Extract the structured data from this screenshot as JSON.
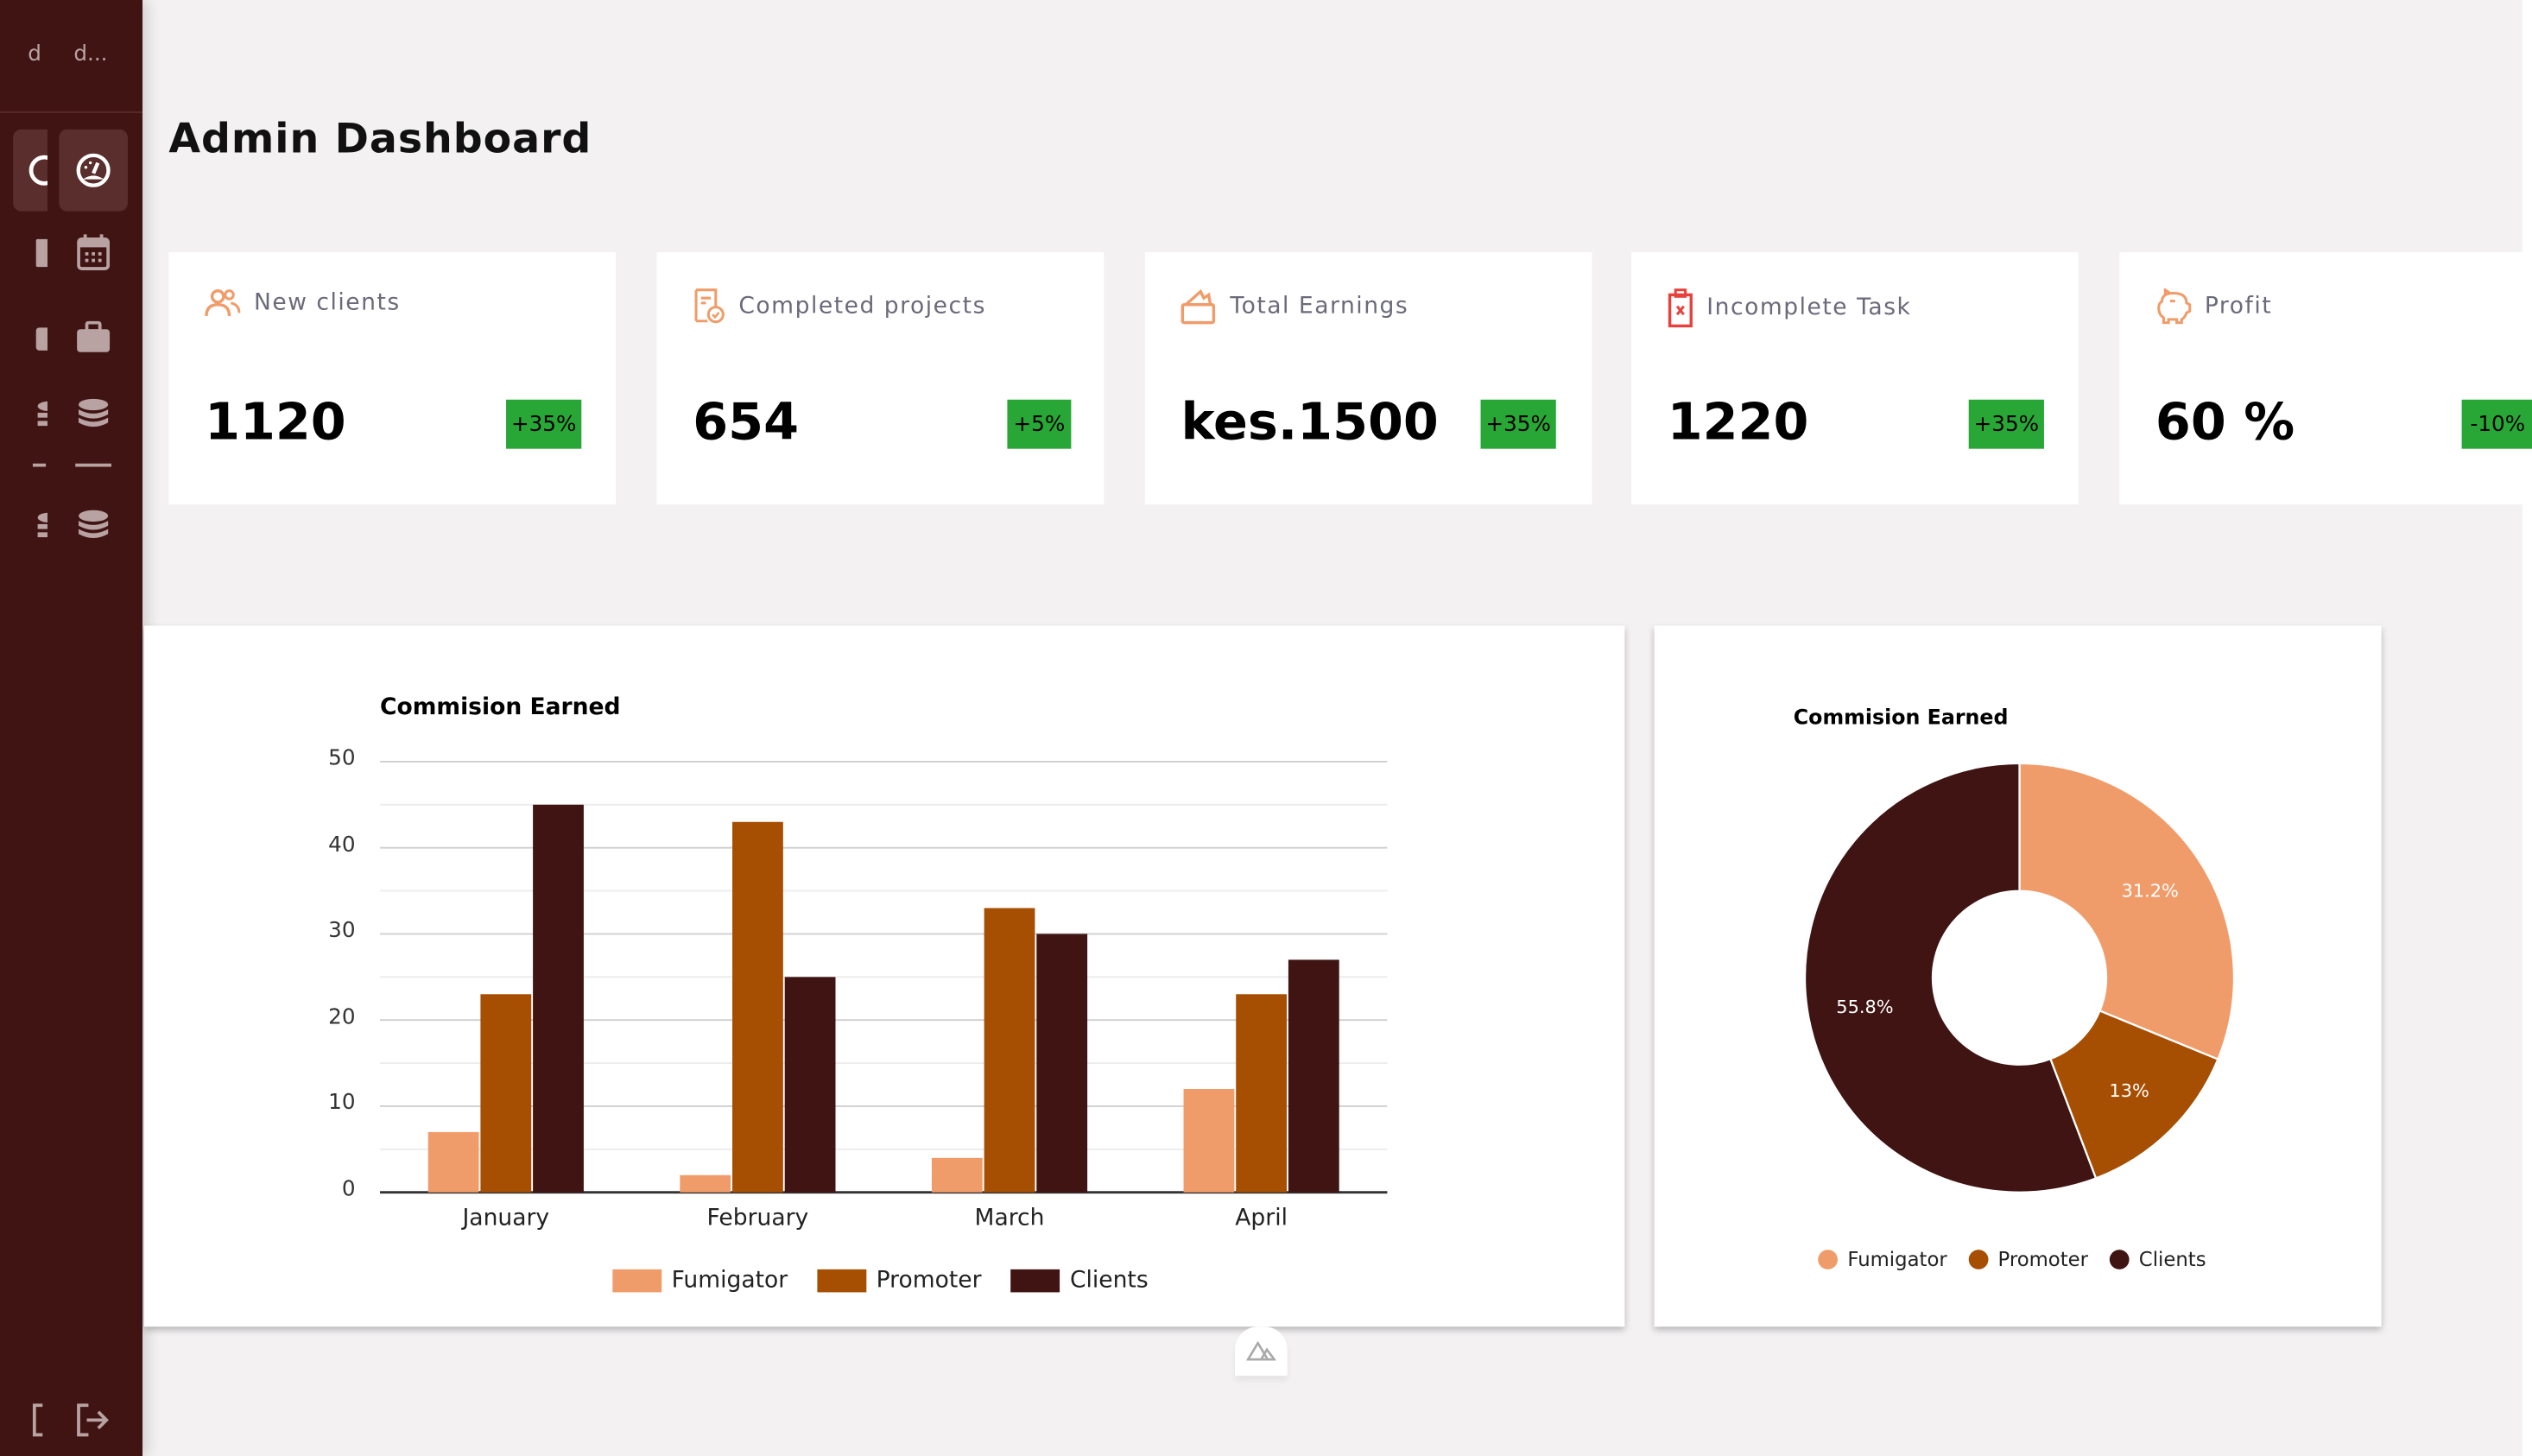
{
  "sidebar": {
    "brand_initial": "d",
    "brand_name": "d...",
    "items": [
      {
        "icon": "dashboard-icon",
        "active": true
      },
      {
        "icon": "calendar-icon"
      },
      {
        "icon": "briefcase-icon"
      },
      {
        "icon": "database-icon"
      },
      {
        "icon": "database-icon"
      }
    ],
    "logout_icon": "logout-icon"
  },
  "page": {
    "title": "Admin Dashboard"
  },
  "cards": [
    {
      "label": "New clients",
      "value": "1120",
      "change": "+35%",
      "icon": "users-icon"
    },
    {
      "label": "Completed projects",
      "value": "654",
      "change": "+5%",
      "icon": "document-check-icon"
    },
    {
      "label": "Total Earnings",
      "value": "kes.1500",
      "change": "+35%",
      "icon": "wallet-icon"
    },
    {
      "label": "Incomplete Task",
      "value": "1220",
      "change": "+35%",
      "icon": "clipboard-x-icon"
    },
    {
      "label": "Profit",
      "value": "60 %",
      "change": "-10%",
      "icon": "piggy-bank-icon"
    }
  ],
  "colors": {
    "sidebar": "#3f1413",
    "badge": "#29a736",
    "fumigator": "#f09c6a",
    "promoter": "#a64f03",
    "clients": "#3f1413",
    "accent": "#f09c6a",
    "danger": "#e8413b"
  },
  "chart_data": [
    {
      "type": "bar",
      "title": "Commision Earned",
      "categories": [
        "January",
        "February",
        "March",
        "April"
      ],
      "series": [
        {
          "name": "Fumigator",
          "values": [
            7,
            2,
            4,
            12
          ]
        },
        {
          "name": "Promoter",
          "values": [
            23,
            43,
            33,
            23
          ]
        },
        {
          "name": "Clients",
          "values": [
            45,
            25,
            30,
            27
          ]
        }
      ],
      "yticks": [
        "0",
        "10",
        "20",
        "30",
        "40",
        "50"
      ],
      "ylim": [
        0,
        50
      ],
      "grid": true,
      "legend": "bottom"
    },
    {
      "type": "pie",
      "title": "Commision Earned",
      "labels": [
        "Fumigator",
        "Promoter",
        "Clients"
      ],
      "values": [
        31.2,
        13,
        55.8
      ],
      "value_labels": [
        "31.2%",
        "13%",
        "55.8%"
      ],
      "donut": true,
      "legend": "bottom"
    }
  ]
}
